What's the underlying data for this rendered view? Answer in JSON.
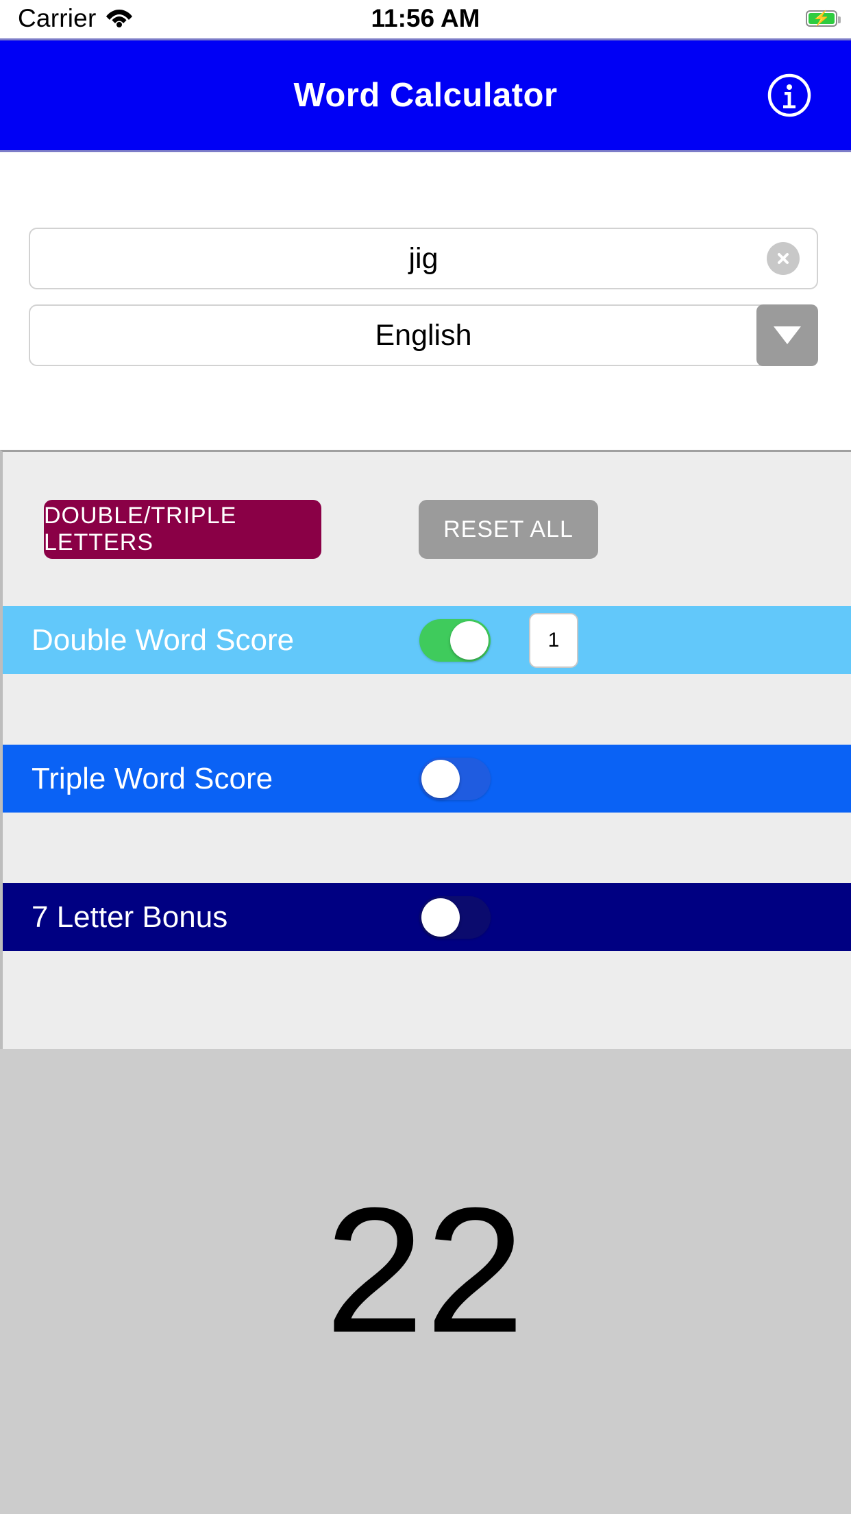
{
  "status_bar": {
    "carrier": "Carrier",
    "wifi_icon": "wifi-icon",
    "time": "11:56 AM",
    "battery_icon": "battery-charging-icon"
  },
  "header": {
    "title": "Word Calculator",
    "info_icon": "info-icon",
    "background_color": "#0000F5",
    "title_color": "#FFFFFF"
  },
  "inputs": {
    "word_field": {
      "value": "jig",
      "placeholder": "",
      "clear_icon": "clear-circle-x-icon"
    },
    "language_field": {
      "value": "English",
      "dropdown_icon": "chevron-down-icon",
      "options": [
        "English"
      ]
    }
  },
  "controls": {
    "double_triple_letters_label": "DOUBLE/TRIPLE LETTERS",
    "double_triple_letters_color": "#8A0046",
    "reset_all_label": "RESET ALL",
    "reset_all_color": "#9B9B9B"
  },
  "score_options": [
    {
      "label": "Double Word Score",
      "row_color": "#62C8FA",
      "toggle_state": "on",
      "toggle_color": "#3FCB5C",
      "multiplier": "1"
    },
    {
      "label": "Triple Word Score",
      "row_color": "#0A62F5",
      "toggle_state": "off",
      "toggle_color": "#1F5CE0",
      "multiplier": null
    },
    {
      "label": "7 Letter Bonus",
      "row_color": "#000082",
      "toggle_state": "off",
      "toggle_color": "#0B0B6E",
      "multiplier": null
    }
  ],
  "result": {
    "score": "22",
    "background_color": "#CCCCCC"
  }
}
